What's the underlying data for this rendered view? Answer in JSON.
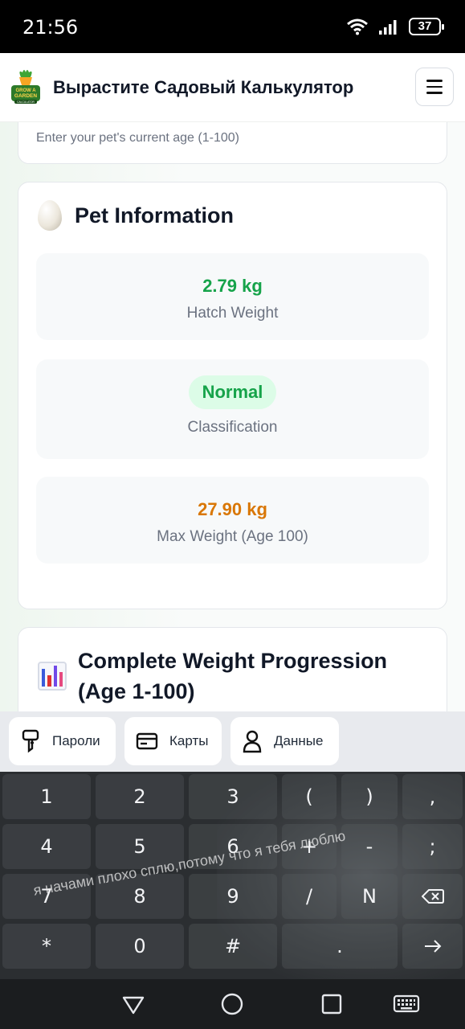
{
  "status_bar": {
    "time": "21:56",
    "battery": "37",
    "icons": [
      "wifi-icon",
      "signal-icon",
      "battery-icon"
    ]
  },
  "header": {
    "logo_text": "GROW A GARDEN CALCULATOR",
    "title": "Вырастите Садовый Калькулятор",
    "menu_icon": "hamburger-icon"
  },
  "age_field": {
    "hint": "Enter your pet's current age (1-100)"
  },
  "pet_info": {
    "icon": "egg-icon",
    "title": "Pet Information",
    "hatch_weight": {
      "value": "2.79 kg",
      "label": "Hatch Weight"
    },
    "classification": {
      "value": "Normal",
      "label": "Classification"
    },
    "max_weight": {
      "value": "27.90 kg",
      "label": "Max Weight (Age 100)"
    }
  },
  "progression": {
    "icon": "bar-chart-icon",
    "title": "Complete Weight Progression (Age 1-100)"
  },
  "autofill": {
    "items": [
      {
        "icon": "key-icon",
        "label": "Пароли"
      },
      {
        "icon": "card-icon",
        "label": "Карты"
      },
      {
        "icon": "person-icon",
        "label": "Данные"
      }
    ]
  },
  "keyboard": {
    "rows": [
      [
        "1",
        "2",
        "3",
        "(",
        ")",
        ","
      ],
      [
        "4",
        "5",
        "6",
        "+",
        "-",
        ";"
      ],
      [
        "7",
        "8",
        "9",
        "/",
        "N",
        "backspace"
      ],
      [
        "*",
        "0",
        "#",
        ".",
        "enter"
      ]
    ],
    "watermark": "я начами плохо сплю,потому что я тебя люблю"
  },
  "nav": {
    "buttons": [
      "back-icon",
      "home-icon",
      "recents-icon",
      "keyboard-icon"
    ]
  },
  "colors": {
    "accent_green": "#16a34a",
    "accent_orange": "#d97706",
    "pill_bg": "#dcfce7"
  }
}
